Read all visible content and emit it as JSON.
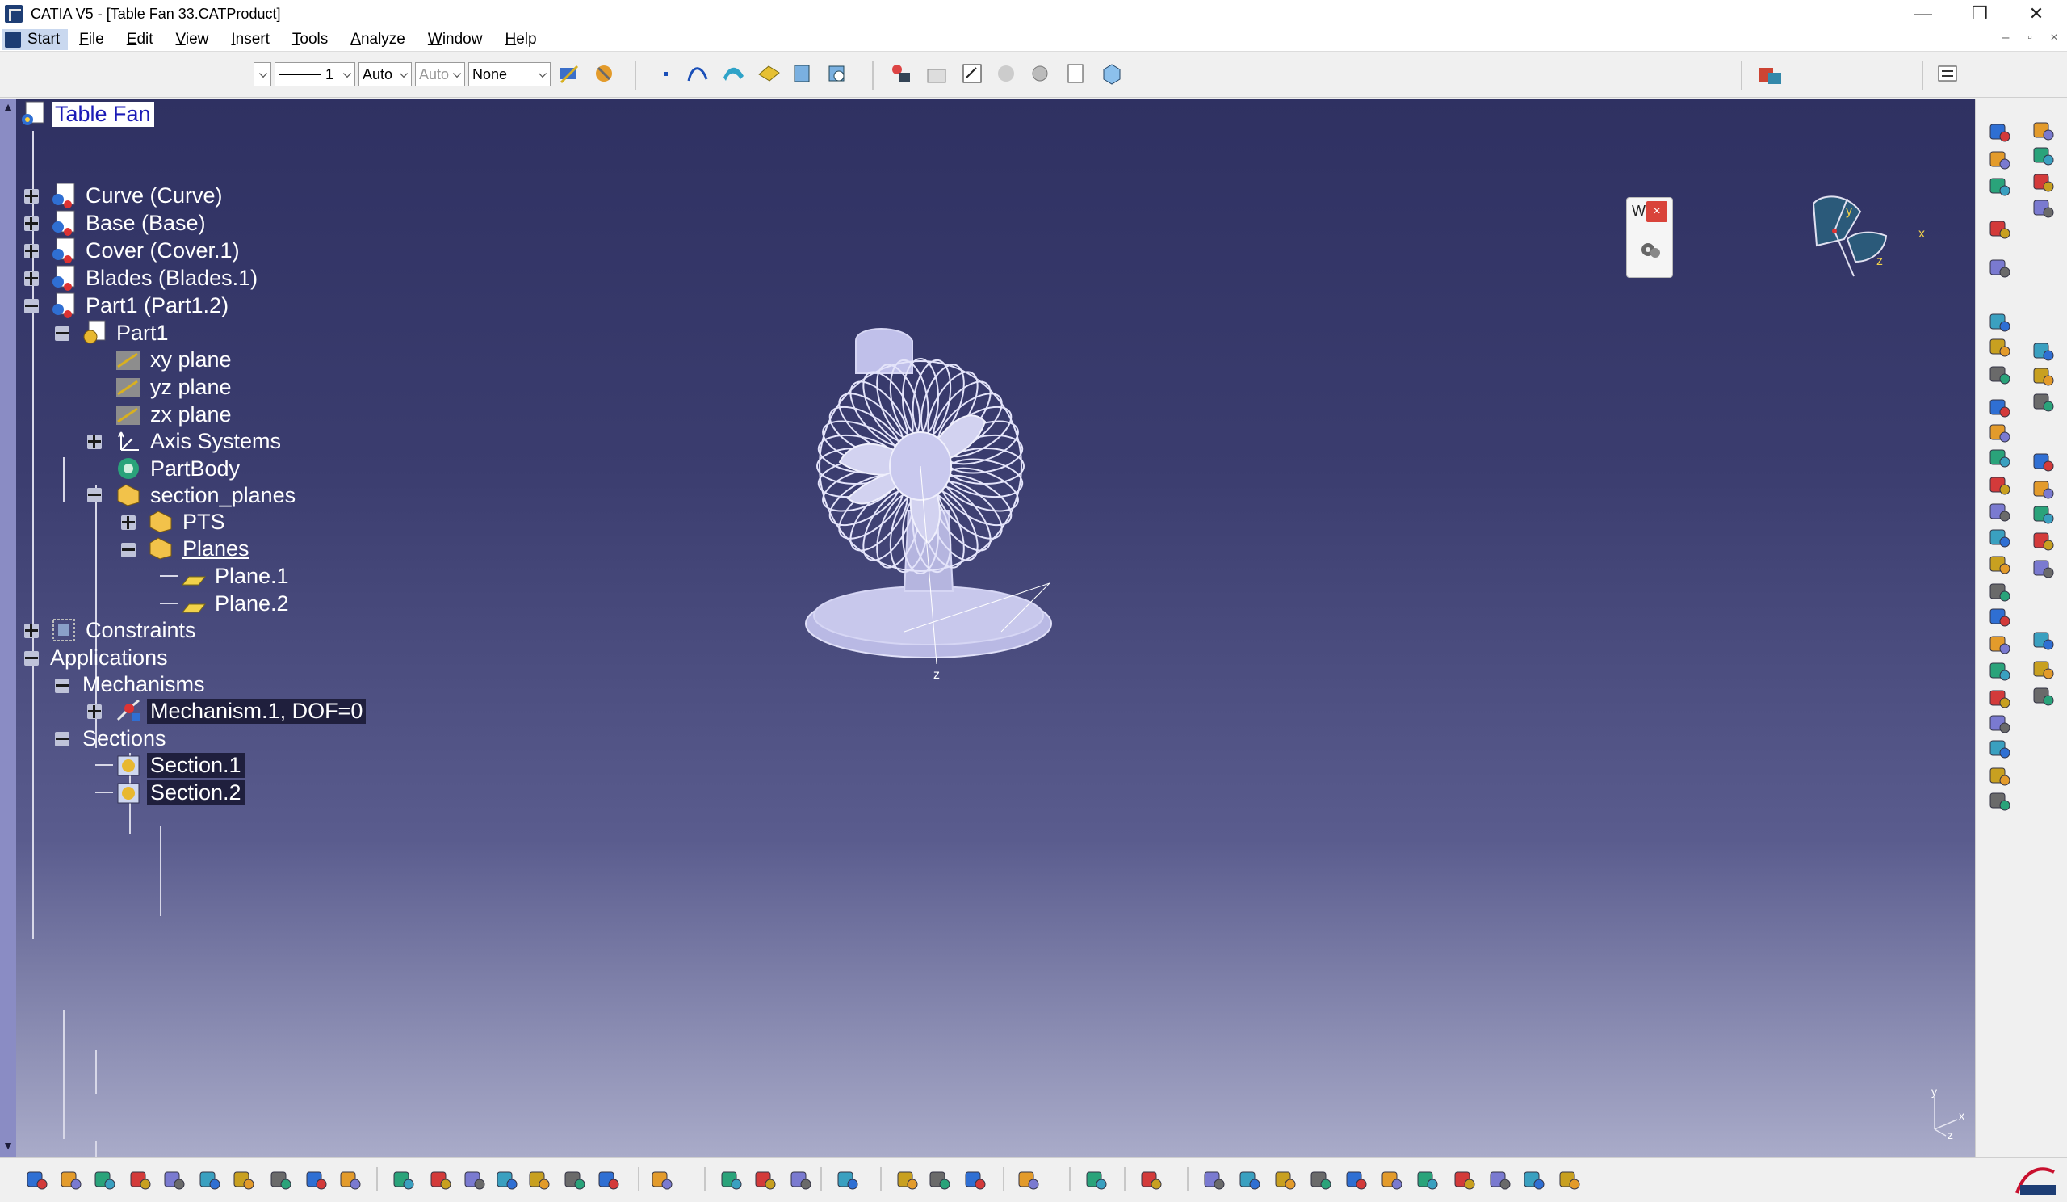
{
  "window": {
    "title": "CATIA V5 - [Table Fan 33.CATProduct]",
    "controls": {
      "minimize": "—",
      "maximize": "❐",
      "close": "✕"
    }
  },
  "menubar": {
    "start": "Start",
    "items": [
      "File",
      "Edit",
      "View",
      "Insert",
      "Tools",
      "Analyze",
      "Window",
      "Help"
    ]
  },
  "toolbar_top": {
    "combo_blank": "",
    "line_weight": "1",
    "line_auto": "Auto",
    "line_auto2": "Auto",
    "layer": "None"
  },
  "tree": {
    "root": "Table Fan",
    "nodes": [
      "Curve (Curve)",
      "Base (Base)",
      "Cover (Cover.1)",
      "Blades (Blades.1)",
      "Part1 (Part1.2)",
      "Part1",
      "xy plane",
      "yz plane",
      "zx plane",
      "Axis Systems",
      "PartBody",
      "section_planes",
      "PTS",
      "Planes",
      "Plane.1",
      "Plane.2",
      "Constraints",
      "Applications",
      "Mechanisms",
      "Mechanism.1, DOF=0",
      "Sections",
      "Section.1",
      "Section.2"
    ]
  },
  "floating_panel": {
    "title": "W",
    "close": "×"
  },
  "compass_labels": {
    "y": "y",
    "x": "x",
    "z": "z"
  },
  "viewport_axis": {
    "y": "y",
    "x": "x",
    "z": "z"
  },
  "model_axis": {
    "z": "z"
  },
  "colors": {
    "viewport_top": "#2f3162",
    "viewport_bottom": "#a9abc9",
    "selection": "#1b1bb6",
    "fan": "#c8c8ec"
  },
  "icons": {
    "top": [
      "line-type-icon",
      "point-icon",
      "curve-icon",
      "surface-icon",
      "sketch-icon",
      "view-icon",
      "manipulate-icon",
      "catalog-icon",
      "product-icon",
      "measure-icon",
      "knowledge-icon",
      "cube-view-icon",
      "settings-icon",
      "workbench-icon"
    ],
    "bottom": [
      "new-icon",
      "open-icon",
      "save-icon",
      "print-icon",
      "cut-icon",
      "copy-icon",
      "paste-icon",
      "undo-icon",
      "redo-icon",
      "whats-this-icon",
      "formula-icon",
      "comment-icon",
      "table-icon",
      "hierarchy-icon",
      "lock-icon",
      "chart-icon",
      "parallelepiped-icon",
      "shading-icon",
      "render-icon",
      "color-icon",
      "grid-icon",
      "distance-icon",
      "measure-icon",
      "clash-icon",
      "section-icon",
      "capture-icon",
      "swap-icon",
      "fly-icon",
      "fit-all-icon",
      "pan-icon",
      "rotate-icon",
      "zoom-in-icon",
      "zoom-out-icon",
      "normal-view-icon",
      "multi-view-icon",
      "iso-view-icon",
      "shading-mode-icon",
      "hide-show-icon",
      "swap-space-icon"
    ],
    "right": [
      "product-icon",
      "assembly-icon",
      "component-icon",
      "existing-component-icon",
      "replace-icon",
      "reorder-icon",
      "multi-instantiate-icon",
      "constraint-icon",
      "coincidence-icon",
      "contact-icon",
      "offset-icon",
      "angle-icon",
      "fix-icon",
      "fix-together-icon",
      "quick-constraint-icon",
      "flexible-icon",
      "change-constraint-icon",
      "reuse-pattern-icon",
      "explode-icon",
      "manipulate-icon",
      "snap-icon",
      "smart-move-icon",
      "clash-icon",
      "section-icon",
      "distance-icon",
      "annotation-icon",
      "text-icon",
      "flag-icon",
      "weld-icon",
      "scene-icon",
      "update-icon",
      "catalog-icon",
      "bill-of-material-icon",
      "publication-icon",
      "save-management-icon",
      "select-icon",
      "mechanism-icon",
      "simulation-icon",
      "kinematics-icon"
    ]
  }
}
